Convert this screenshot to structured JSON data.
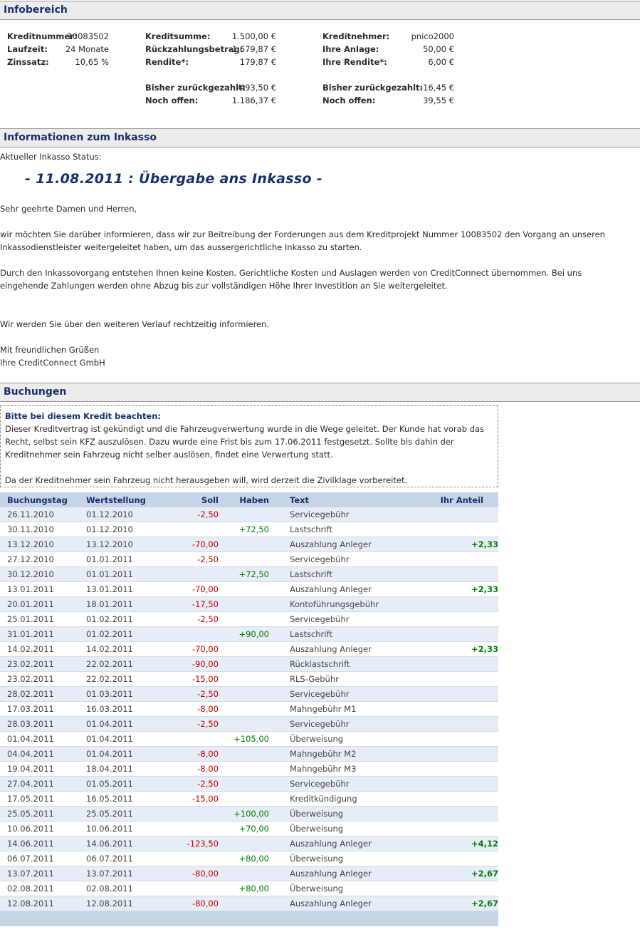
{
  "infobereich": {
    "title": "Infobereich",
    "col1": [
      {
        "label": "Kreditnummer:",
        "value": "10083502"
      },
      {
        "label": "Laufzeit:",
        "value": "24 Monate"
      },
      {
        "label": "Zinssatz:",
        "value": "10,65 %"
      }
    ],
    "col2": [
      {
        "label": "Kreditsumme:",
        "value": "1.500,00 €"
      },
      {
        "label": "Rückzahlungsbetrag:",
        "value": "1.679,87 €"
      },
      {
        "label": "Rendite*:",
        "value": "179,87 €"
      },
      {
        "label": "Bisher zurückgezahlt:",
        "value": "-493,50 €"
      },
      {
        "label": "Noch offen:",
        "value": "1.186,37 €"
      }
    ],
    "col3": [
      {
        "label": "Kreditnehmer:",
        "value": "pnico2000"
      },
      {
        "label": "Ihre Anlage:",
        "value": "50,00 €"
      },
      {
        "label": "Ihre Rendite*:",
        "value": "6,00 €"
      },
      {
        "label": "Bisher zurückgezahlt:",
        "value": "-16,45 €"
      },
      {
        "label": "Noch offen:",
        "value": "39,55 €"
      }
    ]
  },
  "inkasso": {
    "title": "Informationen zum Inkasso",
    "status_label": "Aktueller Inkasso Status:",
    "status_title": "- 11.08.2011 : Übergabe ans Inkasso -",
    "greeting": "Sehr geehrte Damen und Herren,",
    "para1": "wir möchten Sie darüber informieren, dass wir zur Beitreibung der Forderungen aus dem Kreditprojekt Nummer 10083502 den Vorgang an unseren Inkassodienstleister weitergeleitet haben, um das aussergerichtliche Inkasso zu starten.",
    "para2": "Durch den Inkassovorgang entstehen Ihnen keine Kosten. Gerichtliche Kosten und Auslagen werden von CreditConnect übernommen. Bei uns eingehende Zahlungen werden ohne Abzug bis zur vollständigen Höhe Ihrer Investition an Sie weitergeleitet.",
    "para3": "Wir werden Sie über den weiteren Verlauf rechtzeitig informieren.",
    "closing1": "Mit freundlichen Grüßen",
    "closing2": "Ihre CreditConnect GmbH"
  },
  "buchungen": {
    "title": "Buchungen",
    "notice_title": "Bitte bei diesem Kredit beachten:",
    "notice_text": "Dieser Kreditvertrag ist gekündigt und die Fahrzeugverwertung wurde in die Wege geleitet. Der Kunde hat vorab das Recht, selbst sein KFZ auszulösen. Dazu wurde eine Frist bis zum 17.06.2011 festgesetzt. Sollte bis dahin der Kreditnehmer sein Fahrzeug nicht selber auslösen, findet eine Verwertung statt.",
    "notice_text2": "Da der Kreditnehmer sein Fahrzeug nicht herausgeben will, wird derzeit die Zivilklage vorbereitet.",
    "columns": [
      "Buchungstag",
      "Wertstellung",
      "Soll",
      "Haben",
      "Text",
      "Ihr Anteil"
    ],
    "rows": [
      [
        "26.11.2010",
        "01.12.2010",
        "-2,50",
        "",
        "Servicegebühr",
        ""
      ],
      [
        "30.11.2010",
        "01.12.2010",
        "",
        "+72,50",
        "Lastschrift",
        ""
      ],
      [
        "13.12.2010",
        "13.12.2010",
        "-70,00",
        "",
        "Auszahlung Anleger",
        "+2,33"
      ],
      [
        "27.12.2010",
        "01.01.2011",
        "-2,50",
        "",
        "Servicegebühr",
        ""
      ],
      [
        "30.12.2010",
        "01.01.2011",
        "",
        "+72,50",
        "Lastschrift",
        ""
      ],
      [
        "13.01.2011",
        "13.01.2011",
        "-70,00",
        "",
        "Auszahlung Anleger",
        "+2,33"
      ],
      [
        "20.01.2011",
        "18.01.2011",
        "-17,50",
        "",
        "Kontoführungsgebühr",
        ""
      ],
      [
        "25.01.2011",
        "01.02.2011",
        "-2,50",
        "",
        "Servicegebühr",
        ""
      ],
      [
        "31.01.2011",
        "01.02.2011",
        "",
        "+90,00",
        "Lastschrift",
        ""
      ],
      [
        "14.02.2011",
        "14.02.2011",
        "-70,00",
        "",
        "Auszahlung Anleger",
        "+2,33"
      ],
      [
        "23.02.2011",
        "22.02.2011",
        "-90,00",
        "",
        "Rücklastschrift",
        ""
      ],
      [
        "23.02.2011",
        "22.02.2011",
        "-15,00",
        "",
        "RLS-Gebühr",
        ""
      ],
      [
        "28.02.2011",
        "01.03.2011",
        "-2,50",
        "",
        "Servicegebühr",
        ""
      ],
      [
        "17.03.2011",
        "16.03.2011",
        "-8,00",
        "",
        "Mahngebühr M1",
        ""
      ],
      [
        "28.03.2011",
        "01.04.2011",
        "-2,50",
        "",
        "Servicegebühr",
        ""
      ],
      [
        "01.04.2011",
        "01.04.2011",
        "",
        "+105,00",
        "Überweisung",
        ""
      ],
      [
        "04.04.2011",
        "01.04.2011",
        "-8,00",
        "",
        "Mahngebühr M2",
        ""
      ],
      [
        "19.04.2011",
        "18.04.2011",
        "-8,00",
        "",
        "Mahngebühr M3",
        ""
      ],
      [
        "27.04.2011",
        "01.05.2011",
        "-2,50",
        "",
        "Servicegebühr",
        ""
      ],
      [
        "17.05.2011",
        "16.05.2011",
        "-15,00",
        "",
        "Kreditkündigung",
        ""
      ],
      [
        "25.05.2011",
        "25.05.2011",
        "",
        "+100,00",
        "Überweisung",
        ""
      ],
      [
        "10.06.2011",
        "10.06.2011",
        "",
        "+70,00",
        "Überweisung",
        ""
      ],
      [
        "14.06.2011",
        "14.06.2011",
        "-123,50",
        "",
        "Auszahlung Anleger",
        "+4,12"
      ],
      [
        "06.07.2011",
        "06.07.2011",
        "",
        "+80,00",
        "Überweisung",
        ""
      ],
      [
        "13.07.2011",
        "13.07.2011",
        "-80,00",
        "",
        "Auszahlung Anleger",
        "+2,67"
      ],
      [
        "02.08.2011",
        "02.08.2011",
        "",
        "+80,00",
        "Überweisung",
        ""
      ],
      [
        "12.08.2011",
        "12.08.2011",
        "-80,00",
        "",
        "Auszahlung Anleger",
        "+2,67"
      ]
    ]
  }
}
